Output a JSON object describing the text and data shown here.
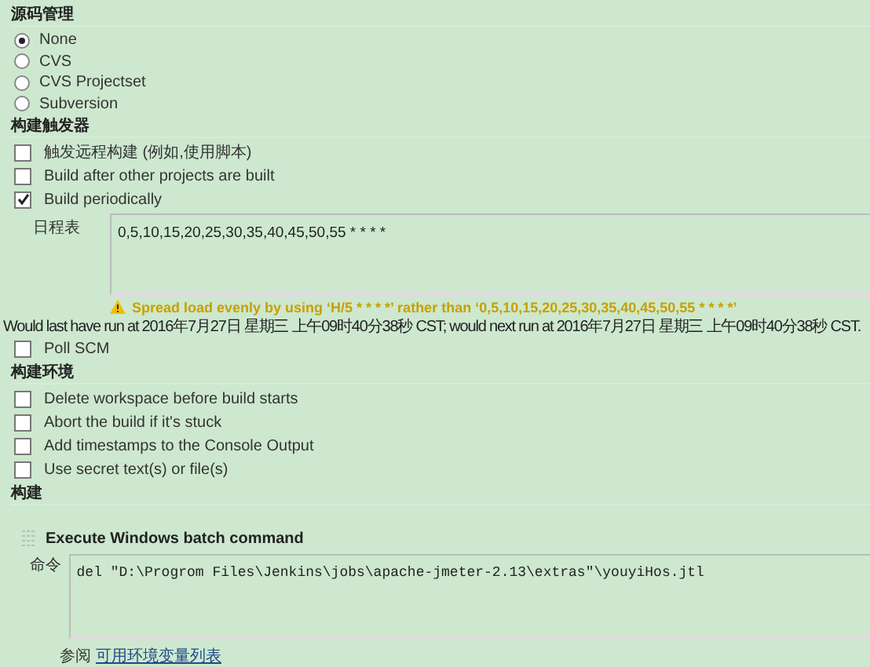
{
  "source_code_management": {
    "title": "源码管理",
    "options": [
      {
        "label": "None",
        "selected": true
      },
      {
        "label": "CVS",
        "selected": false
      },
      {
        "label": "CVS Projectset",
        "selected": false
      },
      {
        "label": "Subversion",
        "selected": false
      }
    ]
  },
  "build_triggers": {
    "title": "构建触发器",
    "options": [
      {
        "label": "触发远程构建 (例如,使用脚本)",
        "checked": false
      },
      {
        "label": "Build after other projects are built",
        "checked": false
      },
      {
        "label": "Build periodically",
        "checked": true,
        "schedule": {
          "label": "日程表",
          "value": "0,5,10,15,20,25,30,35,40,45,50,55 * * * *",
          "warning": "Spread load evenly by using ‘H/5 * * * *’ rather than ‘0,5,10,15,20,25,30,35,40,45,50,55 * * * *’",
          "info": "Would last have run at 2016年7月27日 星期三 上午09时40分38秒 CST; would next run at 2016年7月27日 星期三 上午09时40分38秒 CST."
        }
      },
      {
        "label": "Poll SCM",
        "checked": false
      }
    ]
  },
  "build_environment": {
    "title": "构建环境",
    "options": [
      {
        "label": "Delete workspace before build starts",
        "checked": false
      },
      {
        "label": "Abort the build if it's stuck",
        "checked": false
      },
      {
        "label": "Add timestamps to the Console Output",
        "checked": false
      },
      {
        "label": "Use secret text(s) or file(s)",
        "checked": false
      }
    ]
  },
  "build": {
    "title": "构建",
    "step": {
      "title": "Execute Windows batch command",
      "command_label": "命令",
      "command": "del \"D:\\Progrom Files\\Jenkins\\jobs\\apache-jmeter-2.13\\extras\"\\youyiHos.jtl",
      "help_prefix": "参阅",
      "help_link": "可用环境变量列表"
    }
  }
}
